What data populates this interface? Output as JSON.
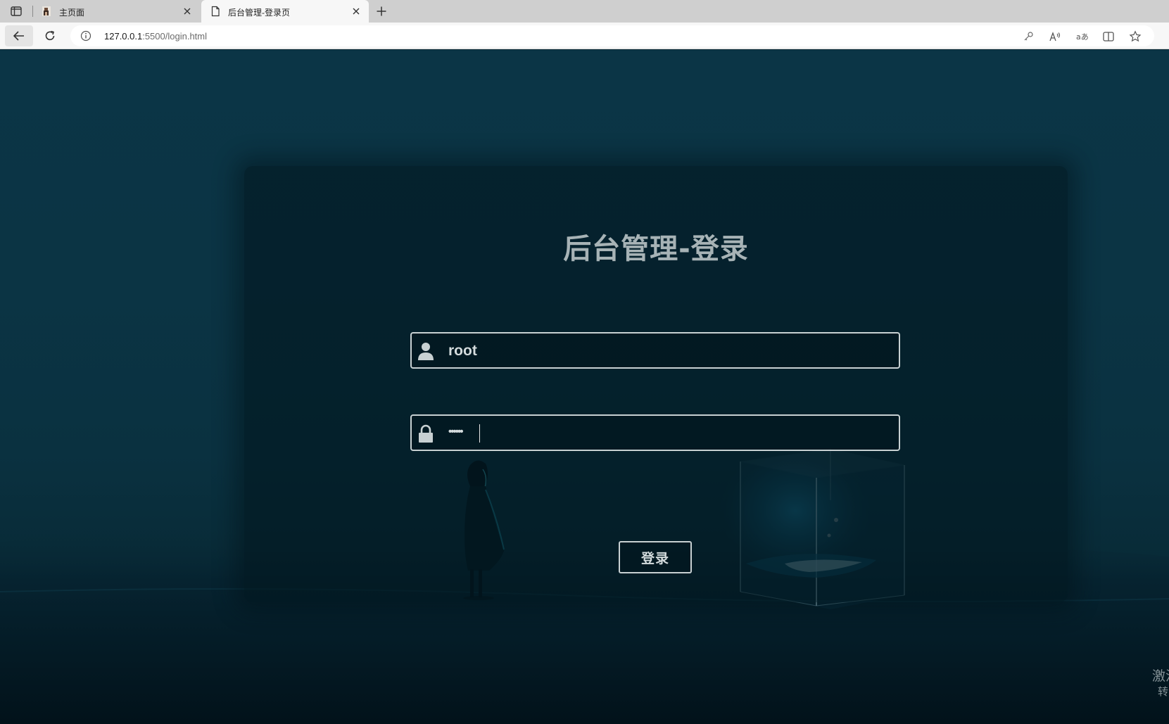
{
  "browser": {
    "tabs": [
      {
        "title": "主页面",
        "active": false,
        "favicon": "page-thumbnail-icon"
      },
      {
        "title": "后台管理-登录页",
        "active": true,
        "favicon": "document-icon"
      }
    ],
    "url_host": "127.0.0.1",
    "url_path": ":5500/login.html",
    "toolbar_icons": [
      "key-icon",
      "read-aloud-icon",
      "translate-icon",
      "split-screen-icon",
      "favorite-star-icon"
    ]
  },
  "login": {
    "title": "后台管理-登录",
    "username_value": "root",
    "password_masked": "••••••",
    "submit_label": "登录"
  },
  "watermark": {
    "line1": "激活",
    "line2": "转到"
  },
  "colors": {
    "background": "#0b3546",
    "card": "#02161e",
    "text": "#a7b3b6",
    "border": "#c8d0d2"
  }
}
